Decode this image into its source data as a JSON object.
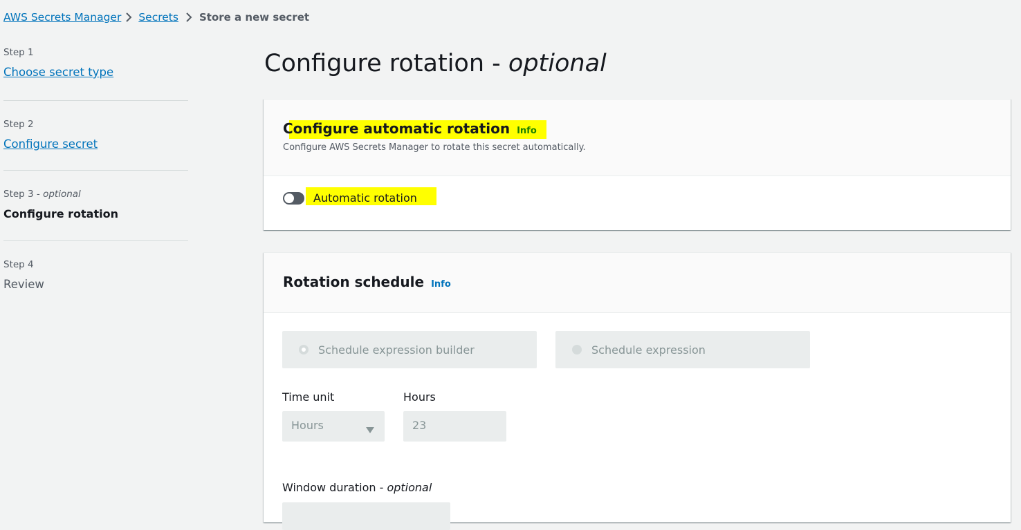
{
  "breadcrumb": {
    "items": [
      "AWS Secrets Manager",
      "Secrets"
    ],
    "current": "Store a new secret"
  },
  "steps": [
    {
      "num": "Step 1",
      "title": "Choose secret type"
    },
    {
      "num": "Step 2",
      "title": "Configure secret"
    },
    {
      "num": "Step 3",
      "optional": "optional",
      "title": "Configure rotation"
    },
    {
      "num": "Step 4",
      "title": "Review"
    }
  ],
  "page": {
    "title": "Configure rotation -",
    "title_optional": "optional"
  },
  "auto_rotation": {
    "title": "Configure automatic rotation",
    "info": "Info",
    "description": "Configure AWS Secrets Manager to rotate this secret automatically.",
    "toggle_label": "Automatic rotation",
    "toggle_on": false
  },
  "schedule": {
    "title": "Rotation schedule",
    "info": "Info",
    "option_builder": "Schedule expression builder",
    "option_expression": "Schedule expression",
    "time_unit_label": "Time unit",
    "time_unit_value": "Hours",
    "hours_label": "Hours",
    "hours_value": "23",
    "window_label": "Window duration -",
    "window_optional": "optional"
  },
  "colors": {
    "link": "#0073bb",
    "highlight": "#ffff00",
    "info_in_highlight": "#1d8102"
  }
}
